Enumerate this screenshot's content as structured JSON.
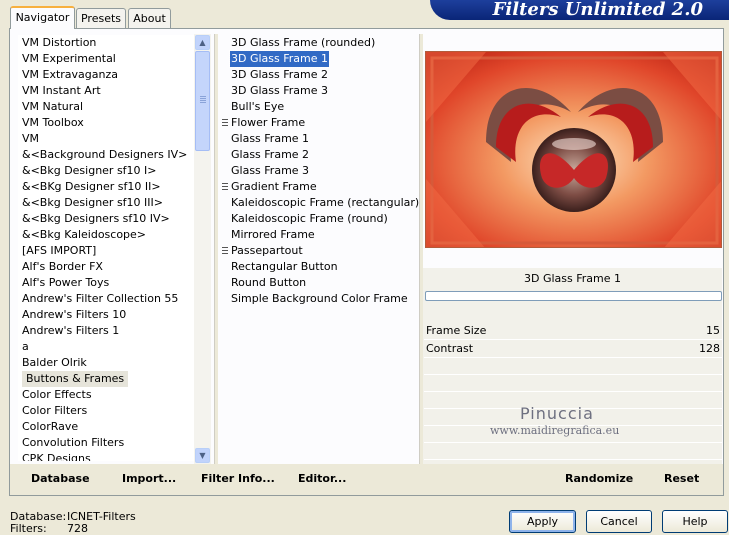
{
  "header": {
    "title": "Filters Unlimited 2.0"
  },
  "tabs": [
    {
      "label": "Navigator",
      "active": true
    },
    {
      "label": "Presets",
      "active": false
    },
    {
      "label": "About",
      "active": false
    }
  ],
  "categories": {
    "selected": "Buttons & Frames",
    "items": [
      "VM Distortion",
      "VM Experimental",
      "VM Extravaganza",
      "VM Instant Art",
      "VM Natural",
      "VM Toolbox",
      "VM",
      "&<Background Designers IV>",
      "&<Bkg Designer sf10 I>",
      "&<BKg Designer sf10 II>",
      "&<Bkg Designer sf10 III>",
      "&<Bkg Designers sf10 IV>",
      "&<Bkg Kaleidoscope>",
      "[AFS IMPORT]",
      "Alf's Border FX",
      "Alf's Power Toys",
      "Andrew's Filter Collection 55",
      "Andrew's Filters 10",
      "Andrew's Filters 1",
      "a",
      "Balder Olrik",
      "Buttons & Frames",
      "Color Effects",
      "Color Filters",
      "ColorRave",
      "Convolution Filters",
      "CPK Designs"
    ]
  },
  "filters": {
    "selected": "3D Glass Frame 1",
    "items": [
      {
        "label": "3D Glass Frame (rounded)",
        "group": false
      },
      {
        "label": "3D Glass Frame 1",
        "group": false
      },
      {
        "label": "3D Glass Frame 2",
        "group": false
      },
      {
        "label": "3D Glass Frame 3",
        "group": false
      },
      {
        "label": "Bull's Eye",
        "group": false
      },
      {
        "label": "Flower Frame",
        "group": true
      },
      {
        "label": "Glass Frame 1",
        "group": false
      },
      {
        "label": "Glass Frame 2",
        "group": false
      },
      {
        "label": "Glass Frame 3",
        "group": false
      },
      {
        "label": "Gradient Frame",
        "group": true
      },
      {
        "label": "Kaleidoscopic Frame (rectangular)",
        "group": false
      },
      {
        "label": "Kaleidoscopic Frame (round)",
        "group": false
      },
      {
        "label": "Mirrored Frame",
        "group": false
      },
      {
        "label": "Passepartout",
        "group": true
      },
      {
        "label": "Rectangular Button",
        "group": false
      },
      {
        "label": "Round Button",
        "group": false
      },
      {
        "label": "Simple Background Color Frame",
        "group": false
      }
    ]
  },
  "preview": {
    "filter_name": "3D Glass Frame 1"
  },
  "params": [
    {
      "label": "Frame Size",
      "value": "15"
    },
    {
      "label": "Contrast",
      "value": "128"
    }
  ],
  "watermark": {
    "name": "Pinuccia",
    "url": "www.maidiregrafica.eu"
  },
  "panel_buttons": {
    "database": "Database",
    "import": "Import...",
    "filter_info": "Filter Info...",
    "editor": "Editor...",
    "randomize": "Randomize",
    "reset": "Reset"
  },
  "footer": {
    "database_label": "Database:",
    "database_value": "ICNET-Filters",
    "filters_label": "Filters:",
    "filters_value": "728"
  },
  "dialog_buttons": {
    "apply": "Apply",
    "cancel": "Cancel",
    "help": "Help"
  },
  "colors": {
    "selection": "#316ac5",
    "banner": "#0a2577",
    "accent_tab": "#f7b03f"
  }
}
